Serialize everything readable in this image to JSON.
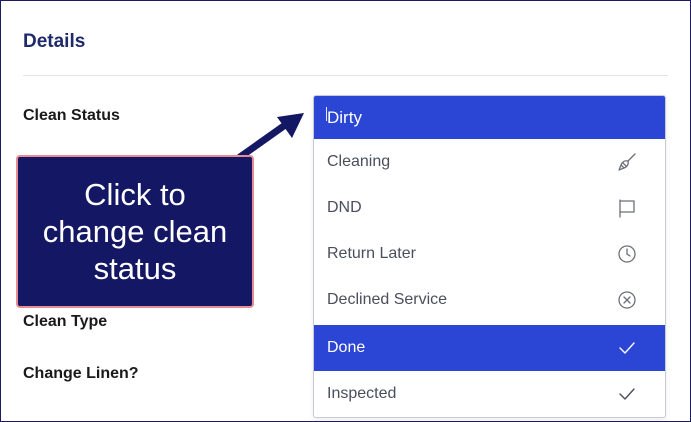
{
  "section": {
    "title": "Details"
  },
  "fields": {
    "clean_status_label": "Clean Status",
    "clean_type_label": "Clean Type",
    "change_linen_label": "Change Linen?"
  },
  "dropdown": {
    "selected_value": "Dirty",
    "options": [
      {
        "label": "Cleaning",
        "icon": "broom-icon",
        "highlighted": false
      },
      {
        "label": "DND",
        "icon": "flag-icon",
        "highlighted": false
      },
      {
        "label": "Return Later",
        "icon": "clock-icon",
        "highlighted": false
      },
      {
        "label": "Declined Service",
        "icon": "x-circle-icon",
        "highlighted": false
      },
      {
        "label": "Done",
        "icon": "checkmark-icon",
        "highlighted": true
      },
      {
        "label": "Inspected",
        "icon": "checkmark-icon",
        "highlighted": false
      }
    ]
  },
  "callout": {
    "text": "Click to\nchange clean\nstatus"
  },
  "colors": {
    "accent": "#2b45d4",
    "callout_bg": "#141764",
    "callout_border": "#e88c93",
    "title": "#1f2a6b"
  }
}
